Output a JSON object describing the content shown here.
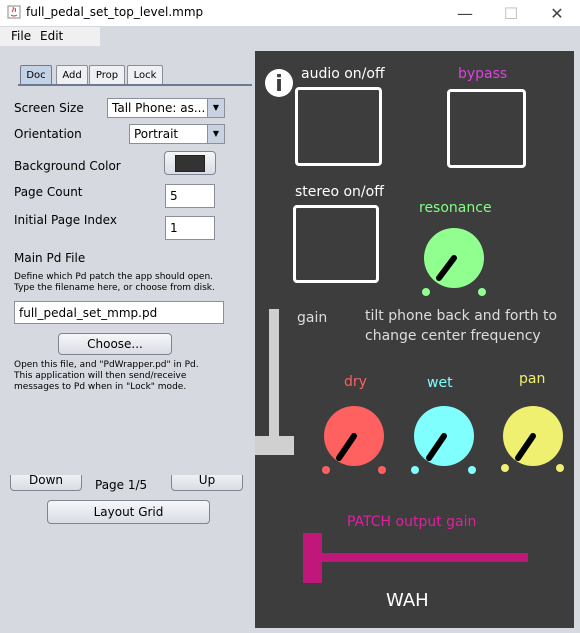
{
  "window": {
    "title": "full_pedal_set_top_level.mmp",
    "minimize": "—",
    "maximize": "☐",
    "close": "✕"
  },
  "menu": {
    "file": "File",
    "edit": "Edit"
  },
  "tabs": [
    {
      "label": "Doc"
    },
    {
      "label": "Add"
    },
    {
      "label": "Prop"
    },
    {
      "label": "Lock"
    }
  ],
  "doc": {
    "screen_size_label": "Screen Size",
    "screen_size_value": "Tall Phone: as...",
    "orientation_label": "Orientation",
    "orientation_value": "Portrait",
    "bg_color_label": "Background Color",
    "bg_color_value": "#333333",
    "page_count_label": "Page Count",
    "page_count_value": "5",
    "initial_page_label": "Initial Page Index",
    "initial_page_value": "1",
    "main_pd_heading": "Main Pd File",
    "main_pd_help_1": "Define which Pd patch the app should open.",
    "main_pd_help_2": "Type the filename here, or choose from disk.",
    "main_pd_value": "full_pedal_set_mmp.pd",
    "choose_label": "Choose...",
    "open_help_1": "Open this file, and \"PdWrapper.pd\" in Pd.",
    "open_help_2": "This application will then send/receive",
    "open_help_3": "messages to Pd when in \"Lock\" mode."
  },
  "pager": {
    "down": "Down",
    "page": "Page 1/5",
    "up": "Up",
    "layout_grid": "Layout Grid"
  },
  "canvas": {
    "info_glyph": "i",
    "audio_label": "audio on/off",
    "bypass_label": "bypass",
    "stereo_label": "stereo on/off",
    "resonance_label": "resonance",
    "gain_label": "gain",
    "tilt_line1": "tilt phone back and forth to",
    "tilt_line2": "change center frequency",
    "dry_label": "dry",
    "wet_label": "wet",
    "pan_label": "pan",
    "patch_gain_label": "PATCH output gain",
    "wah_label": "WAH",
    "colors": {
      "bypass": "#e040e0",
      "resonance_text": "#80ff80",
      "resonance_knob": "#90ff90",
      "dry": "#ff6060",
      "wet": "#80ffff",
      "pan": "#f0f070",
      "patch": "#c0187a"
    }
  }
}
